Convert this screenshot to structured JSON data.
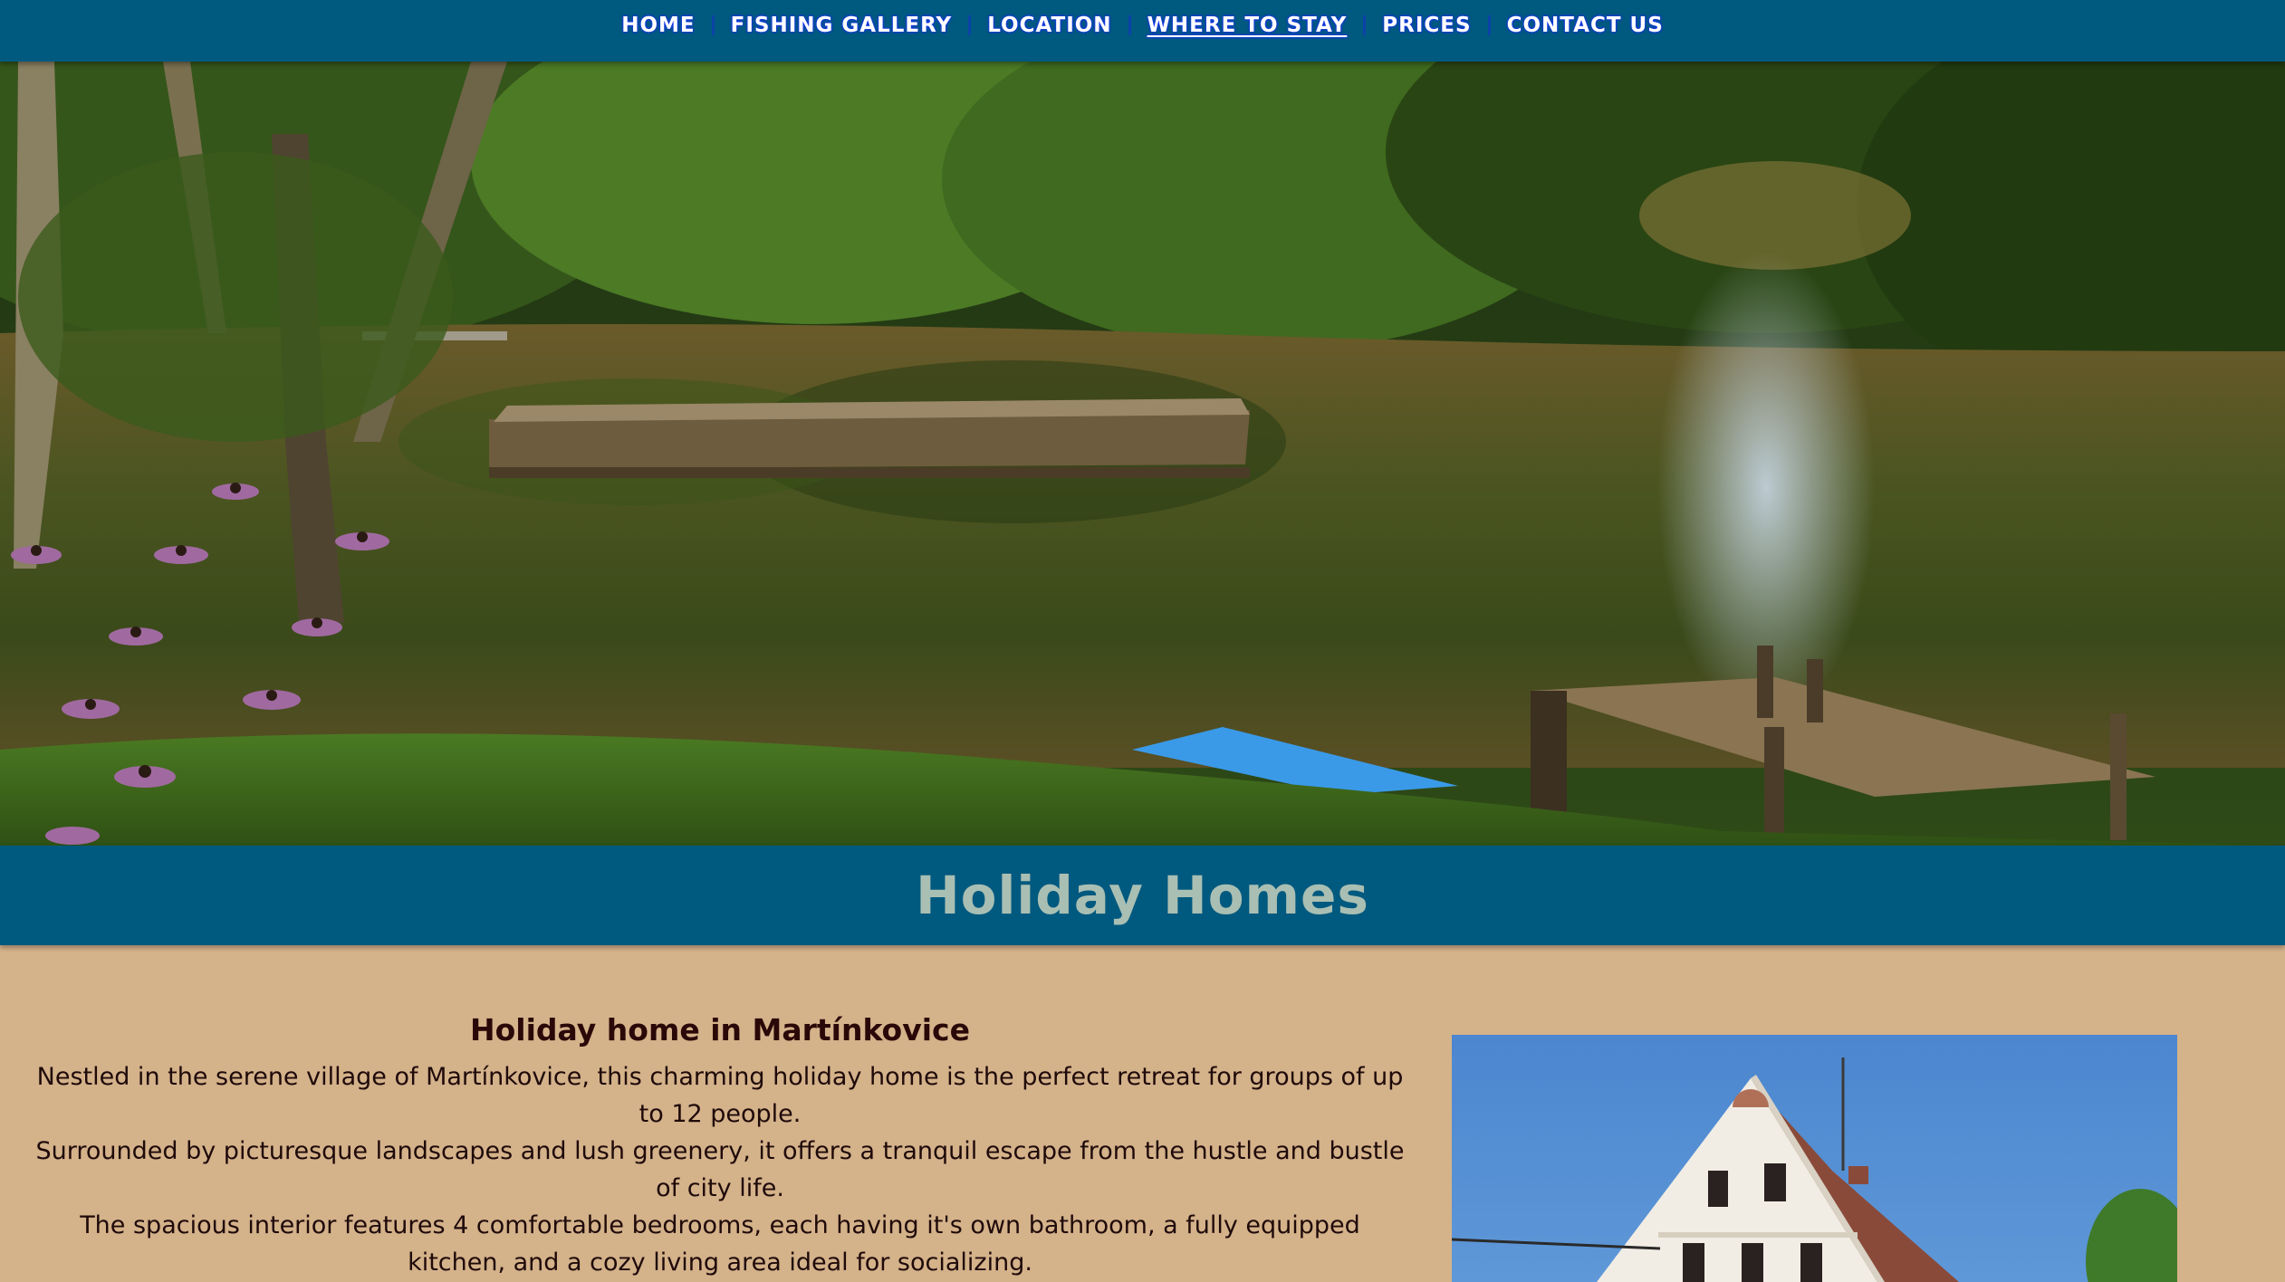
{
  "nav": {
    "items": [
      {
        "label": "HOME",
        "active": false
      },
      {
        "label": "FISHING GALLERY",
        "active": false
      },
      {
        "label": "LOCATION",
        "active": false
      },
      {
        "label": "WHERE TO STAY",
        "active": true
      },
      {
        "label": "PRICES",
        "active": false
      },
      {
        "label": "CONTACT US",
        "active": false
      }
    ]
  },
  "hero": {
    "scene": "fishing-pond",
    "colors": {
      "trees": "#3b5a1c",
      "water": "#6b5a2a",
      "grass": "#3f6a1d",
      "boat": "#3a9ae8"
    }
  },
  "banner": {
    "title": "Holiday Homes"
  },
  "main": {
    "heading": "Holiday home in Martínkovice",
    "paragraphs": [
      "Nestled in the serene village of Martínkovice, this charming holiday home is the perfect retreat for groups of up to 12 people.",
      "Surrounded by picturesque landscapes and lush greenery, it offers a tranquil escape from the hustle and bustle of city life.",
      "The spacious interior features 4 comfortable bedrooms, each having it's own bathroom, a fully equipped kitchen, and a cozy living area ideal for socializing."
    ]
  },
  "colors": {
    "nav_bg": "#00597f",
    "page_bg": "#d4b28a",
    "banner_title": "#a9bfb3",
    "text": "#1f0a0a"
  }
}
